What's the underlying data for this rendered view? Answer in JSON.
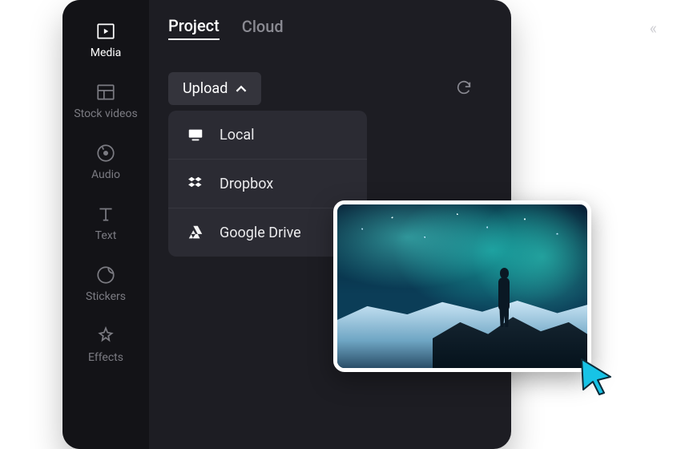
{
  "sidebar": {
    "items": [
      {
        "label": "Media",
        "icon": "media-play-icon"
      },
      {
        "label": "Stock videos",
        "icon": "stock-grid-icon"
      },
      {
        "label": "Audio",
        "icon": "audio-disc-icon"
      },
      {
        "label": "Text",
        "icon": "text-icon"
      },
      {
        "label": "Stickers",
        "icon": "sticker-circle-icon"
      },
      {
        "label": "Effects",
        "icon": "effects-sparkle-icon"
      }
    ],
    "active_index": 0
  },
  "header": {
    "tabs": [
      {
        "label": "Project"
      },
      {
        "label": "Cloud"
      }
    ],
    "active_index": 0,
    "collapse_glyph": "«"
  },
  "upload": {
    "button_label": "Upload",
    "dropdown": [
      {
        "label": "Local",
        "icon": "monitor-icon"
      },
      {
        "label": "Dropbox",
        "icon": "dropbox-icon"
      },
      {
        "label": "Google Drive",
        "icon": "google-drive-icon"
      }
    ]
  },
  "refresh_icon": "refresh-icon",
  "thumbnail": {
    "description": "aurora-landscape-photo"
  },
  "colors": {
    "bg_panel": "#1d1d23",
    "bg_sidebar": "#131317",
    "bg_dropdown": "#2b2b33",
    "text_active": "#ffffff",
    "text_inactive": "#8a8a92",
    "cursor_accent": "#17c3e6"
  }
}
